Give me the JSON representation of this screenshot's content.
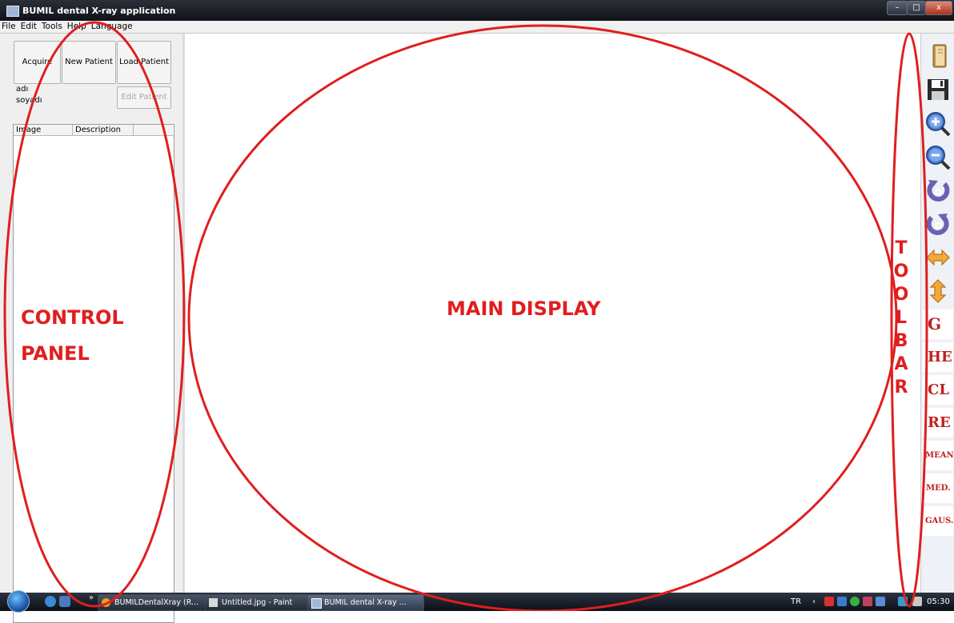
{
  "window": {
    "title": "BUMIL dental X-ray application",
    "controls": {
      "minimize": "–",
      "maximize": "□",
      "close": "x"
    }
  },
  "menu": [
    "File",
    "Edit",
    "Tools",
    "Help",
    "Language"
  ],
  "control_panel": {
    "buttons": {
      "acquire": "Acquire",
      "new_patient": "New Patient",
      "load_patient": "Load Patient",
      "edit_patient": "Edit Patient"
    },
    "fields": {
      "first_name": "adı",
      "last_name": "soyadı"
    },
    "table": {
      "columns": [
        "Image",
        "Description"
      ],
      "rows": []
    }
  },
  "toolbar": {
    "icons": [
      "open-book-icon",
      "save-disk-icon",
      "zoom-in-icon",
      "zoom-out-icon",
      "rotate-left-icon",
      "rotate-right-icon",
      "flip-horizontal-icon",
      "flip-vertical-icon"
    ],
    "text_buttons": [
      "G",
      "HE",
      "CL",
      "RE",
      "MEAN",
      "MED.",
      "GAUS."
    ]
  },
  "taskbar": {
    "tasks": [
      "BUMILDentalXray (R...",
      "Untitled.jpg - Paint",
      "BUMIL dental X-ray ..."
    ],
    "overflow": "»",
    "language": "TR",
    "clock": "05:30"
  },
  "annotations": {
    "control_panel_line1": "CONTROL",
    "control_panel_line2": "PANEL",
    "main_display": "MAIN DISPLAY",
    "toolbar_letters": [
      "T",
      "O",
      "O",
      "L",
      "B",
      "A",
      "R"
    ],
    "color": "#e01e1e"
  }
}
